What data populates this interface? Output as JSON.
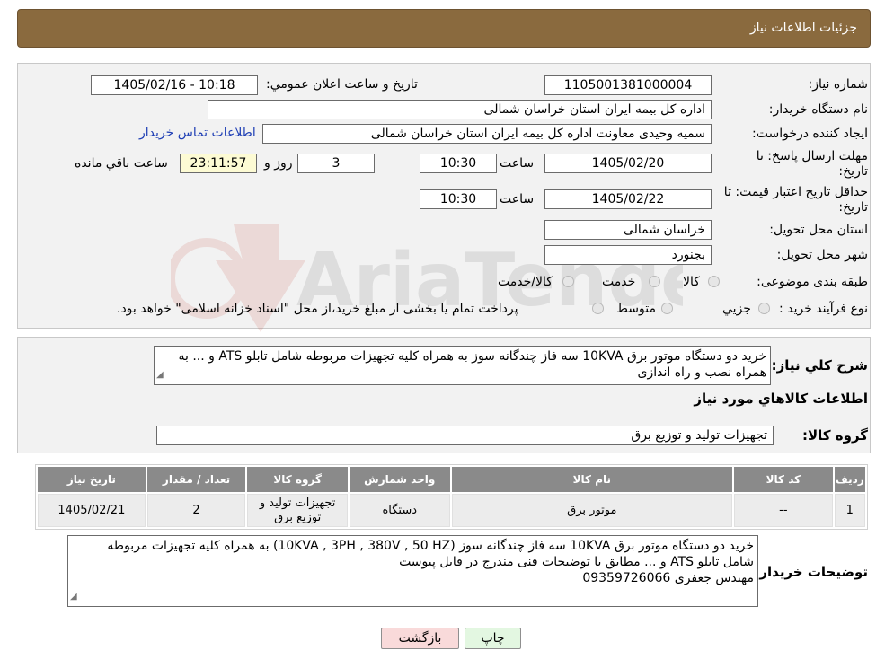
{
  "header": {
    "title": "جزئیات اطلاعات نیاز"
  },
  "fields": {
    "need_number_label": "شماره نیاز:",
    "need_number": "1105001381000004",
    "announce_label": "تاریخ و ساعت اعلان عمومي:",
    "announce_value": "1405/02/16 - 10:18",
    "buyer_org_label": "نام دستگاه خریدار:",
    "buyer_org": "اداره کل بیمه ایران استان خراسان شمالی",
    "creator_label": "ایجاد کننده درخواست:",
    "creator": "سمیه وحیدی معاونت اداره کل بیمه ایران استان خراسان شمالی",
    "contact_link": "اطلاعات تماس خریدار",
    "deadline_label": "مهلت ارسال پاسخ: تا تاریخ:",
    "deadline_date": "1405/02/20",
    "time_label": "ساعت",
    "deadline_time": "10:30",
    "days": "3",
    "days_label": "روز و",
    "remaining": "23:11:57",
    "remaining_label": "ساعت باقي مانده",
    "validity_label": "حداقل تاریخ اعتبار قیمت: تا تاریخ:",
    "validity_date": "1405/02/22",
    "validity_time": "10:30",
    "province_label": "استان محل تحویل:",
    "province": "خراسان شمالی",
    "city_label": "شهر محل تحویل:",
    "city": "بجنورد",
    "category_label": "طبقه بندی موضوعی:",
    "category_options": [
      "کالا",
      "خدمت",
      "کالا/خدمت"
    ],
    "process_label": "نوع فرآیند خرید :",
    "process_options": [
      "جزیي",
      "متوسط"
    ],
    "process_note": "پرداخت تمام یا بخشی از مبلغ خرید،از محل \"اسناد خزانه اسلامی\" خواهد بود."
  },
  "description": {
    "label": "شرح کلي نياز:",
    "text": "خرید دو دستگاه موتور برق 10KVA سه فاز چندگانه سوز به همراه کلیه تجهیزات مربوطه شامل تابلو ATS و ... به همراه نصب و راه اندازی"
  },
  "goods_section": {
    "title": "اطلاعات کالاهاي مورد نياز",
    "group_label": "گروه کالا:",
    "group_value": "تجهیزات تولید و توزیع برق"
  },
  "table": {
    "headers": [
      "رديف",
      "کد کالا",
      "نام کالا",
      "واحد شمارش",
      "گروه کالا",
      "تعداد / مقدار",
      "تاريخ نياز"
    ],
    "rows": [
      [
        "1",
        "--",
        "موتور برق",
        "دستگاه",
        "تجهیزات تولید و توزیع برق",
        "2",
        "1405/02/21"
      ]
    ]
  },
  "buyer_notes": {
    "label": "توضیحات خریدار:",
    "lines": [
      "خرید دو دستگاه موتور برق 10KVA سه فاز چندگانه سوز (10KVA , 3PH , 380V , 50 HZ) به همراه کلیه تجهیزات مربوطه",
      "شامل تابلو ATS و ... مطابق با توضیحات فنی مندرج در فایل پیوست",
      "مهندس جعفری 09359726066"
    ]
  },
  "buttons": {
    "print": "چاپ",
    "back": "بازگشت"
  },
  "colors": {
    "header_bg": "#8a6a3e",
    "link": "#1f3fb5",
    "yellow_box": "#fdfbd4",
    "back_btn": "#f9dada",
    "print_btn": "#e3f7e1"
  }
}
